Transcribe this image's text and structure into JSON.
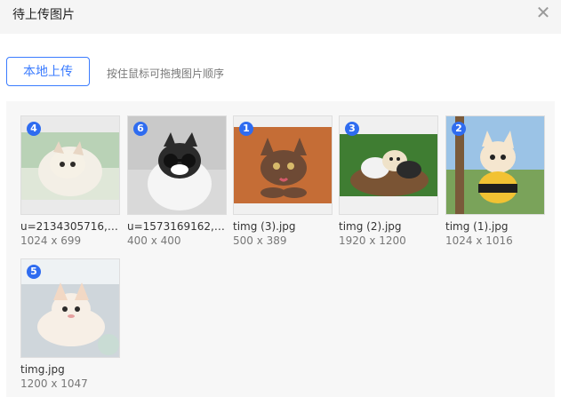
{
  "dialog": {
    "title": "待上传图片",
    "close_icon": "close-icon"
  },
  "toolbar": {
    "upload_label": "本地上传",
    "hint": "按住鼠标可拖拽图片顺序"
  },
  "images": [
    {
      "order": "4",
      "name": "u=2134305716,2...",
      "size": "1024 x 699"
    },
    {
      "order": "6",
      "name": "u=1573169162,2...",
      "size": "400 x 400"
    },
    {
      "order": "1",
      "name": "timg (3).jpg",
      "size": "500 x 389"
    },
    {
      "order": "3",
      "name": "timg (2).jpg",
      "size": "1920 x 1200"
    },
    {
      "order": "2",
      "name": "timg (1).jpg",
      "size": "1024 x 1016"
    },
    {
      "order": "5",
      "name": "timg.jpg",
      "size": "1200 x 1047"
    }
  ]
}
